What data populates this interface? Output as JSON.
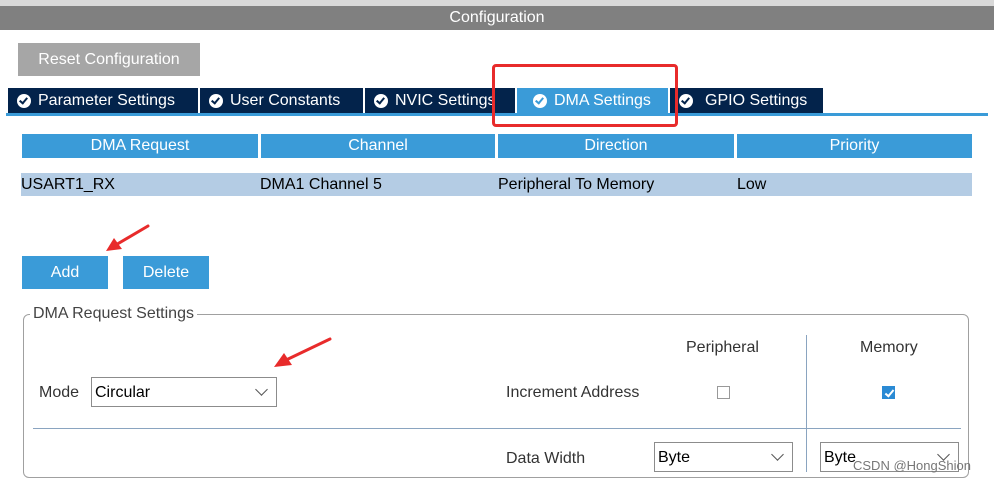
{
  "window": {
    "title": "Configuration"
  },
  "toolbar": {
    "reset_label": "Reset Configuration"
  },
  "tabs": [
    {
      "label": "Parameter Settings",
      "active": false
    },
    {
      "label": "User Constants",
      "active": false
    },
    {
      "label": "NVIC Settings",
      "active": false
    },
    {
      "label": "DMA Settings",
      "active": true
    },
    {
      "label": "GPIO Settings",
      "active": false
    }
  ],
  "table": {
    "headers": [
      "DMA Request",
      "Channel",
      "Direction",
      "Priority"
    ],
    "rows": [
      [
        "USART1_RX",
        "DMA1 Channel 5",
        "Peripheral To Memory",
        "Low"
      ]
    ]
  },
  "actions": {
    "add_label": "Add",
    "delete_label": "Delete"
  },
  "settings": {
    "legend": "DMA Request Settings",
    "mode_label": "Mode",
    "mode_value": "Circular",
    "peripheral_header": "Peripheral",
    "memory_header": "Memory",
    "increment_label": "Increment Address",
    "peripheral_increment": false,
    "memory_increment": true,
    "data_width_label": "Data Width",
    "peripheral_width": "Byte",
    "memory_width": "Byte"
  },
  "watermark": "CSDN @HongShion",
  "colors": {
    "accent": "#3a9bd8",
    "tab_dark": "#03234b",
    "highlight_red": "#e82b2b",
    "row_selected": "#b4cce4"
  }
}
